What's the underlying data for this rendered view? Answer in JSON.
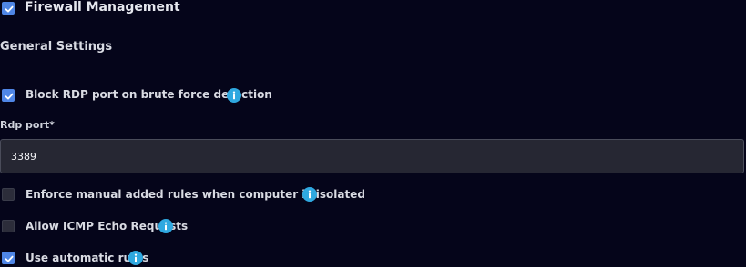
{
  "header": {
    "title": "Firewall Management",
    "enabled": true
  },
  "general_settings": {
    "heading": "General Settings",
    "block_rdp": {
      "label": "Block RDP port on brute force detection",
      "checked": true,
      "icon": "info-icon"
    },
    "rdp_port": {
      "label": "Rdp port*",
      "value": "3389"
    },
    "enforce_manual_rules": {
      "label": "Enforce manual added rules when computer is isolated",
      "checked": false,
      "icon": "info-icon"
    },
    "allow_icmp": {
      "label": "Allow ICMP Echo Requests",
      "checked": false,
      "icon": "info-icon"
    },
    "automatic_rules": {
      "label": "Use automatic rules",
      "checked": true,
      "icon": "info-icon"
    }
  },
  "colors": {
    "background": "#05051a",
    "accent": "#4f86e6",
    "info": "#2fa8e0",
    "input_bg": "#262733"
  }
}
